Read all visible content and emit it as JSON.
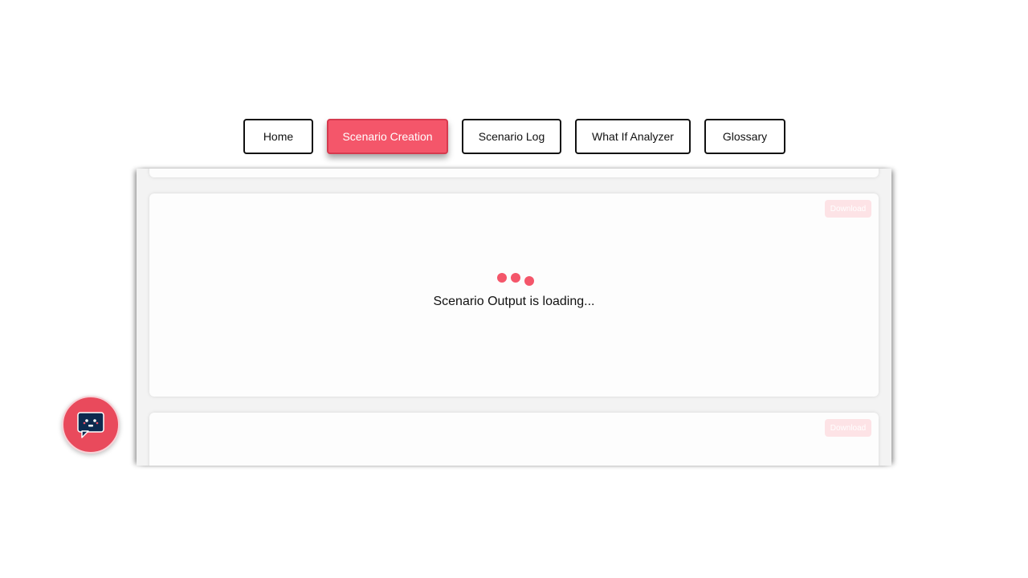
{
  "nav": {
    "items": [
      {
        "label": "Home",
        "active": false
      },
      {
        "label": "Scenario Creation",
        "active": true
      },
      {
        "label": "Scenario Log",
        "active": false
      },
      {
        "label": "What If Analyzer",
        "active": false
      },
      {
        "label": "Glossary",
        "active": false
      }
    ]
  },
  "main": {
    "output_card": {
      "download_label": "Download",
      "loading_text": "Scenario Output is loading..."
    },
    "next_card": {
      "download_label": "Download"
    }
  },
  "chat": {
    "icon": "chat-bot-icon"
  },
  "colors": {
    "accent": "#f4566a",
    "download_bg": "#fde3e6",
    "panel_bg": "#f3f3f3",
    "chat_icon": "#0d2a4f"
  }
}
